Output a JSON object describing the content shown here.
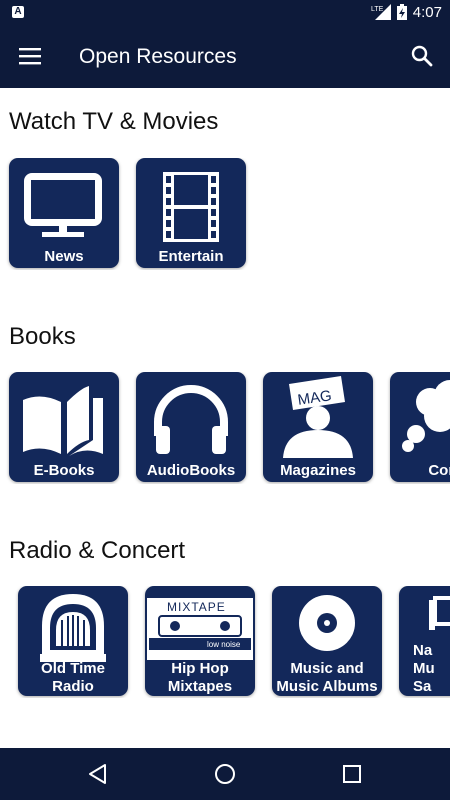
{
  "status_bar": {
    "network": "LTE",
    "time": "4:07",
    "notification_icon": "a-icon"
  },
  "app_bar": {
    "title": "Open Resources",
    "menu_icon": "hamburger-menu-icon",
    "search_icon": "search-icon"
  },
  "sections": [
    {
      "title": "Watch TV & Movies",
      "tiles": [
        {
          "label": "News",
          "icon": "tv-icon"
        },
        {
          "label": "Entertain",
          "icon": "film-strip-icon"
        }
      ]
    },
    {
      "title": "Books",
      "tiles": [
        {
          "label": "E-Books",
          "icon": "open-book-icon"
        },
        {
          "label": "AudioBooks",
          "icon": "headphones-icon"
        },
        {
          "label": "Magazines",
          "icon": "magazine-reader-icon",
          "icon_text": "MAG"
        },
        {
          "label": "Com",
          "icon": "thought-cloud-icon"
        }
      ]
    },
    {
      "title": "Radio & Concert",
      "tiles": [
        {
          "label": "Old Time\nRadio",
          "line1": "Old Time",
          "line2": "Radio",
          "icon": "vintage-radio-icon"
        },
        {
          "label": "Hip Hop\nMixtapes",
          "line1": "Hip Hop",
          "line2": "Mixtapes",
          "icon": "cassette-tape-icon",
          "icon_text": "MIXTAPE",
          "icon_text2": "low noise"
        },
        {
          "label": "Music and\nMusic Albums",
          "line1": "Music and",
          "line2": "Music Albums",
          "icon": "vinyl-record-icon"
        },
        {
          "label": "Na\nMu\nSa",
          "line1": "Na",
          "line2": "Mu",
          "line3": "Sa",
          "icon": "music-sheet-icon"
        }
      ]
    }
  ],
  "nav_bar": {
    "back_icon": "back-triangle-icon",
    "home_icon": "home-circle-icon",
    "recents_icon": "recents-square-icon"
  },
  "colors": {
    "primary_dark": "#0d1a3a",
    "tile": "#13285a",
    "text": "#111111",
    "on_primary": "#ffffff"
  }
}
